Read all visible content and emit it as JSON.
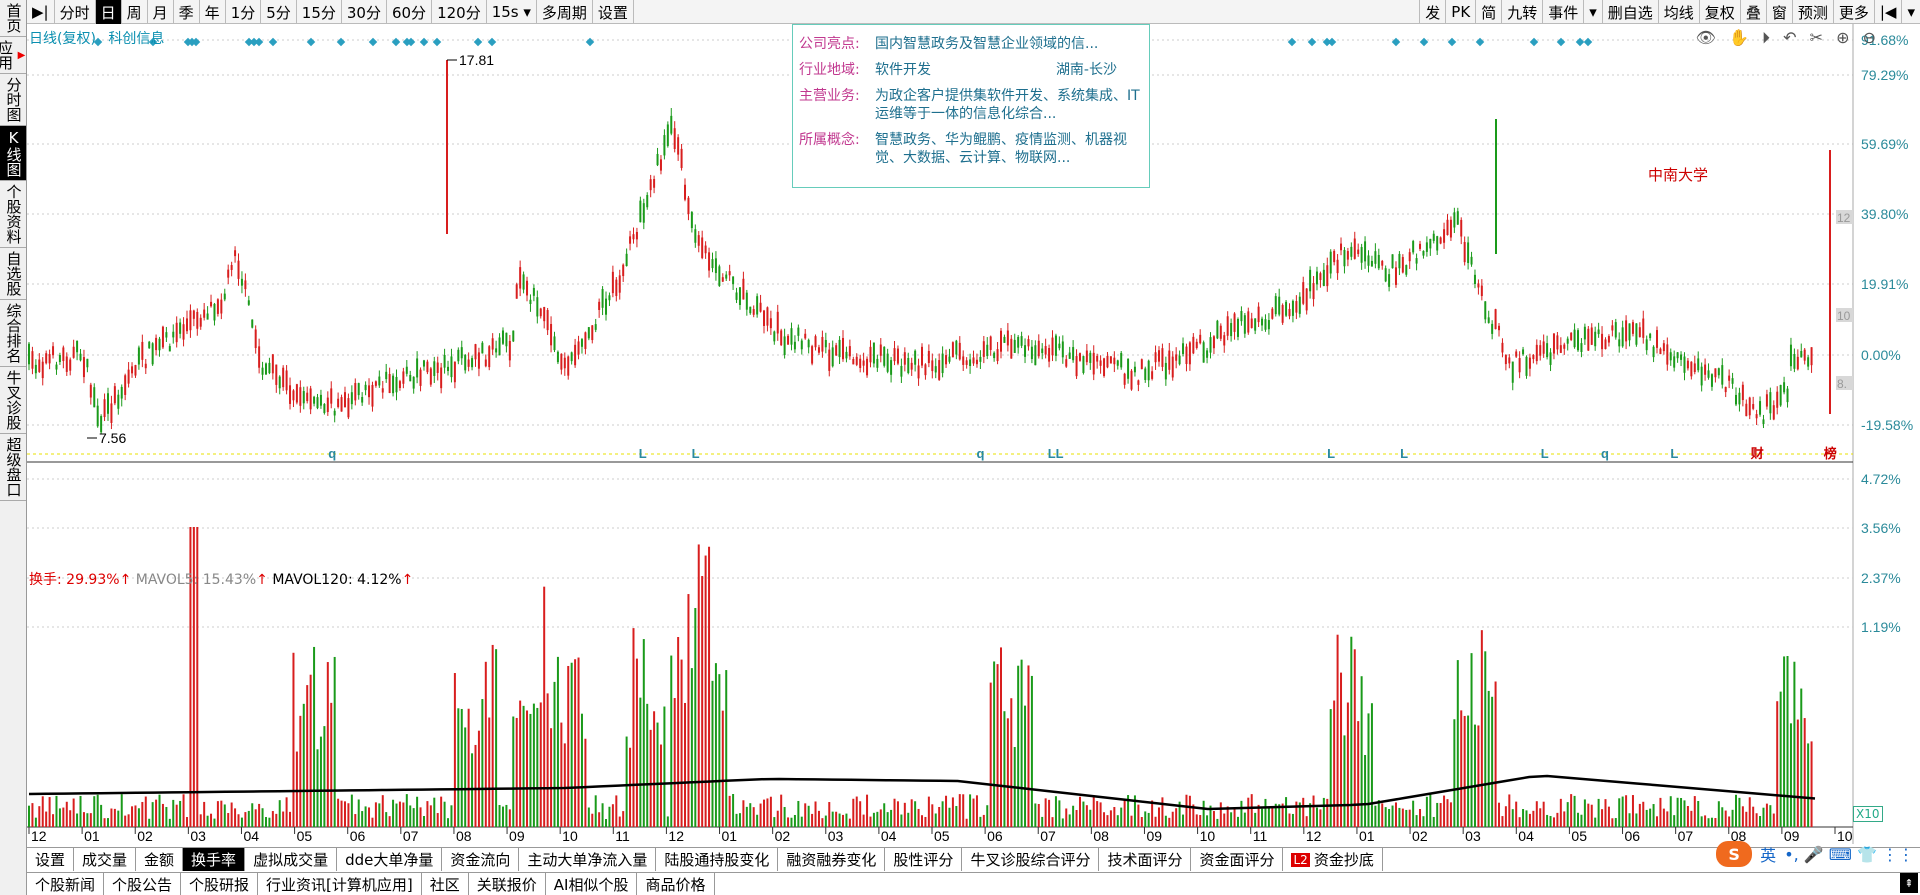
{
  "sidebar": {
    "items": [
      {
        "label": "首页",
        "active": false
      },
      {
        "label": "应用",
        "active": false,
        "icon": "play-icon"
      },
      {
        "label": "分时图",
        "active": false
      },
      {
        "label": "K线图",
        "active": true
      },
      {
        "label": "个股资料",
        "active": false
      },
      {
        "label": "自选股",
        "active": false
      },
      {
        "label": "综合排名",
        "active": false
      },
      {
        "label": "牛叉诊股",
        "active": false
      },
      {
        "label": "超级盘口",
        "active": false
      }
    ]
  },
  "toolbar": {
    "left": [
      "▶|",
      "分时",
      "日",
      "周",
      "月",
      "季",
      "年",
      "1分",
      "5分",
      "15分",
      "30分",
      "60分",
      "120分",
      "15s ▾",
      "多周期",
      "设置"
    ],
    "active_index": 2,
    "right": [
      "发",
      "PK",
      "简",
      "九转",
      "事件",
      "▾",
      "删自选",
      "均线",
      "复权",
      "叠",
      "窗",
      "预测",
      "更多",
      "|◀",
      "▾"
    ]
  },
  "chart": {
    "title": "日线(复权)",
    "subtitle": "科创信息",
    "right_icons": "👁 ✋ ⏵ ↶ ✂ ⊕ ⊖",
    "high_label": "17.81",
    "low_label": "7.56",
    "pct_axis": [
      "91.68%",
      "79.29%",
      "59.69%",
      "39.80%",
      "19.91%",
      "0.00%",
      "-19.58%"
    ],
    "side_values": [
      "12",
      "10",
      "8."
    ],
    "annotation": "中南大学",
    "marker_letters": [
      {
        "text": "q",
        "x": 0.165
      },
      {
        "text": "L",
        "x": 0.335
      },
      {
        "text": "L",
        "x": 0.364
      },
      {
        "text": "q",
        "x": 0.52
      },
      {
        "text": "LL",
        "x": 0.559
      },
      {
        "text": "L",
        "x": 0.712
      },
      {
        "text": "L",
        "x": 0.752
      },
      {
        "text": "L",
        "x": 0.829
      },
      {
        "text": "q",
        "x": 0.862
      },
      {
        "text": "L",
        "x": 0.9
      },
      {
        "text": "财",
        "x": 0.944
      },
      {
        "text": "榜",
        "x": 0.984
      }
    ]
  },
  "info_popup": {
    "rows": [
      {
        "key": "公司亮点:",
        "value": "国内智慧政务及智慧企业领域的信..."
      },
      {
        "key": "行业地域:",
        "value": "软件开发",
        "value2": "湖南-长沙"
      },
      {
        "key": "主营业务:",
        "value": "为政企客户提供集软件开发、系统集成、IT运维等于一体的信息化综合..."
      },
      {
        "key": "所属概念:",
        "value": "智慧政务、华为鲲鹏、疫情监测、机器视觉、大数据、云计算、物联网..."
      }
    ]
  },
  "turnover": {
    "label": "换手: 29.93%",
    "mavol5": "MAVOL5: 15.43%",
    "mavol120": "MAVOL120: 4.12%",
    "axis": [
      "4.72%",
      "3.56%",
      "2.37%",
      "1.19%"
    ],
    "x10": "X10"
  },
  "x_axis": [
    "12",
    "01",
    "02",
    "03",
    "04",
    "05",
    "06",
    "07",
    "08",
    "09",
    "10",
    "11",
    "12",
    "01",
    "02",
    "03",
    "04",
    "05",
    "06",
    "07",
    "08",
    "09",
    "10",
    "11",
    "12",
    "01",
    "02",
    "03",
    "04",
    "05",
    "06",
    "07",
    "08",
    "09",
    "10"
  ],
  "tabs1": [
    "设置",
    "成交量",
    "金额",
    "换手率",
    "虚拟成交量",
    "dde大单净量",
    "资金流向",
    "主动大单净流入量",
    "陆股通持股变化",
    "融资融券变化",
    "股性评分",
    "牛叉诊股综合评分",
    "技术面评分",
    "资金面评分",
    "资金抄底"
  ],
  "tabs1_active": 3,
  "l2_badge": "L2",
  "tabs2": [
    "个股新闻",
    "个股公告",
    "个股研报",
    "行业资讯[计算机应用]",
    "社区",
    "关联报价",
    "AI相似个股",
    "商品价格"
  ],
  "ime": {
    "logo": "S",
    "lang": "英",
    "symbols": "•, 🎤 ⌨ 👕 ⋮⋮"
  },
  "corner": "⇞",
  "colors": {
    "up": "#d81e1e",
    "down": "#1a9a1a",
    "axis": "#2a8a9a",
    "diamond": "#2a9fc0"
  }
}
